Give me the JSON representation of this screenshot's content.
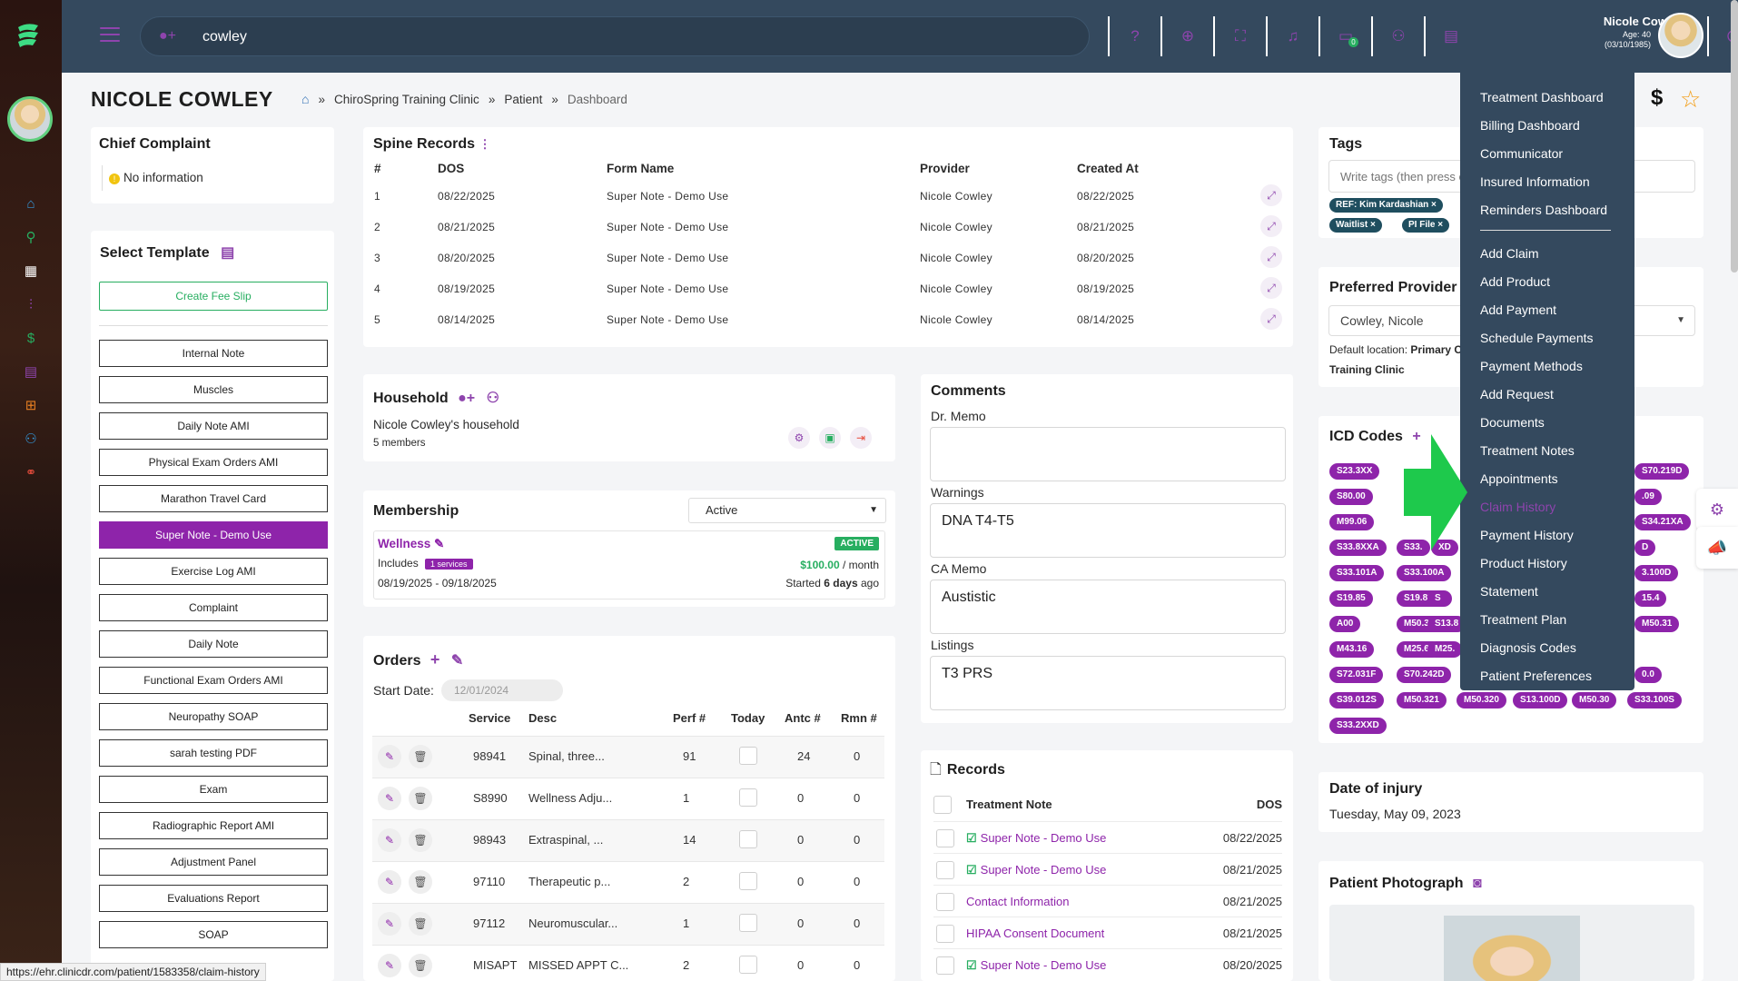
{
  "topbar": {
    "search_value": "cowley",
    "user_name": "Nicole Cowley",
    "user_age": "Age: 40",
    "user_dob": "(03/10/1985)",
    "message_badge": "0"
  },
  "page": {
    "title": "NICOLE COWLEY",
    "breadcrumb": [
      "ChiroSpring Training Clinic",
      "Patient",
      "Dashboard"
    ],
    "dollar": "$"
  },
  "chief_complaint": {
    "title": "Chief Complaint",
    "text": "No information"
  },
  "select_template": {
    "title": "Select Template",
    "create_fee_slip": "Create Fee Slip",
    "templates": [
      "Internal Note",
      "Muscles",
      "Daily Note AMI",
      "Physical Exam Orders AMI",
      "Marathon Travel Card",
      "Super Note - Demo Use",
      "Exercise Log AMI",
      "Complaint",
      "Daily Note",
      "Functional Exam Orders AMI",
      "Neuropathy SOAP",
      "sarah testing PDF",
      "Exam",
      "Radiographic Report AMI",
      "Adjustment Panel",
      "Evaluations Report",
      "SOAP"
    ]
  },
  "spine_records": {
    "title": "Spine Records",
    "headers": [
      "#",
      "DOS",
      "Form Name",
      "Provider",
      "Created At"
    ],
    "rows": [
      [
        "1",
        "08/22/2025",
        "Super Note - Demo Use",
        "Nicole Cowley",
        "08/22/2025"
      ],
      [
        "2",
        "08/21/2025",
        "Super Note - Demo Use",
        "Nicole Cowley",
        "08/21/2025"
      ],
      [
        "3",
        "08/20/2025",
        "Super Note - Demo Use",
        "Nicole Cowley",
        "08/20/2025"
      ],
      [
        "4",
        "08/19/2025",
        "Super Note - Demo Use",
        "Nicole Cowley",
        "08/19/2025"
      ],
      [
        "5",
        "08/14/2025",
        "Super Note - Demo Use",
        "Nicole Cowley",
        "08/14/2025"
      ]
    ]
  },
  "household": {
    "title": "Household",
    "name": "Nicole Cowley's household",
    "members": "5 members"
  },
  "membership": {
    "title": "Membership",
    "status_select": "Active",
    "plan": "Wellness",
    "status_badge": "ACTIVE",
    "includes_label": "Includes",
    "services_badge": "1 services",
    "price": "$100.00",
    "period": "/ month",
    "dates": "08/19/2025 - 09/18/2025",
    "started_prefix": "Started",
    "started_days": "6 days",
    "started_suffix": "ago"
  },
  "orders": {
    "title": "Orders",
    "start_date_label": "Start Date:",
    "start_date_value": "12/01/2024",
    "headers": [
      "Service",
      "Desc",
      "Perf #",
      "Today",
      "Antc #",
      "Rmn #"
    ],
    "rows": [
      [
        "98941",
        "Spinal, three...",
        "91",
        "24",
        "0"
      ],
      [
        "S8990",
        "Wellness Adju...",
        "1",
        "0",
        "0"
      ],
      [
        "98943",
        "Extraspinal, ...",
        "14",
        "0",
        "0"
      ],
      [
        "97110",
        "Therapeutic p...",
        "2",
        "0",
        "0"
      ],
      [
        "97112",
        "Neuromuscular...",
        "1",
        "0",
        "0"
      ],
      [
        "MISAPT",
        "MISSED APPT C...",
        "2",
        "0",
        "0"
      ]
    ]
  },
  "comments": {
    "title": "Comments",
    "dr_memo_label": "Dr. Memo",
    "dr_memo": "",
    "warnings_label": "Warnings",
    "warnings": "DNA T4-T5",
    "ca_memo_label": "CA Memo",
    "ca_memo": "Austistic",
    "listings_label": "Listings",
    "listings": "T3 PRS"
  },
  "records": {
    "title": "Records",
    "header_left": "Treatment Note",
    "header_right": "DOS",
    "rows": [
      {
        "label": "Super Note - Demo Use",
        "date": "08/22/2025",
        "checked": true
      },
      {
        "label": "Super Note - Demo Use",
        "date": "08/21/2025",
        "checked": true
      },
      {
        "label": "Contact Information",
        "date": "08/21/2025",
        "checked": false
      },
      {
        "label": "HIPAA Consent Document",
        "date": "08/21/2025",
        "checked": false
      },
      {
        "label": "Super Note - Demo Use",
        "date": "08/20/2025",
        "checked": true
      }
    ]
  },
  "tags": {
    "title": "Tags",
    "placeholder": "Write tags (then press enter to add each)",
    "items": [
      "REF: Kim Kardashian",
      "Waitlist",
      "PI File"
    ]
  },
  "preferred_provider": {
    "title": "Preferred Provider",
    "value": "Cowley, Nicole",
    "default_location_label": "Default location:",
    "default_location_value": "Primary ChiroSpring",
    "location_line2": "Training Clinic"
  },
  "icd_codes": {
    "title": "ICD Codes",
    "rows": [
      [
        "S23.3XX",
        "",
        "",
        "S70.219D"
      ],
      [
        "S80.00",
        "",
        "",
        ".09"
      ],
      [
        "M99.06",
        "",
        "",
        "S34.21XA"
      ],
      [
        "S33.8XXA",
        "S33.",
        "XD",
        "D"
      ],
      [
        "S33.101A",
        "S33.100A",
        "",
        "3.100D"
      ],
      [
        "S19.85",
        "S19.82XS",
        "S",
        "15.4"
      ],
      [
        "A00",
        "M50.323",
        "S13.8",
        "M50.31"
      ],
      [
        "M43.16",
        "M25.60",
        "M25.",
        ""
      ],
      [
        "S72.031F",
        "S70.242D",
        "",
        "0.0"
      ],
      [
        "S39.012S",
        "M50.321",
        "M50.320",
        "S13.100D",
        "M50.30",
        "S33.100S"
      ],
      [
        "S33.2XXD"
      ]
    ]
  },
  "date_of_injury": {
    "title": "Date of injury",
    "value": "Tuesday, May 09, 2023"
  },
  "patient_photo": {
    "title": "Patient Photograph"
  },
  "menu": {
    "group1": [
      "Treatment Dashboard",
      "Billing Dashboard",
      "Communicator",
      "Insured Information",
      "Reminders Dashboard"
    ],
    "group2": [
      "Add Claim",
      "Add Product",
      "Add Payment",
      "Schedule Payments",
      "Payment Methods",
      "Add Request",
      "Documents",
      "Treatment Notes",
      "Appointments",
      "Claim History",
      "Payment History",
      "Product History",
      "Statement",
      "Treatment Plan",
      "Diagnosis Codes",
      "Patient Preferences"
    ]
  },
  "status_url": "https://ehr.clinicdr.com/patient/1583358/claim-history",
  "colors": {
    "topbar": "#34495e",
    "accent": "#8e24aa",
    "success": "#27ae60",
    "arrow": "#1ec94c"
  }
}
